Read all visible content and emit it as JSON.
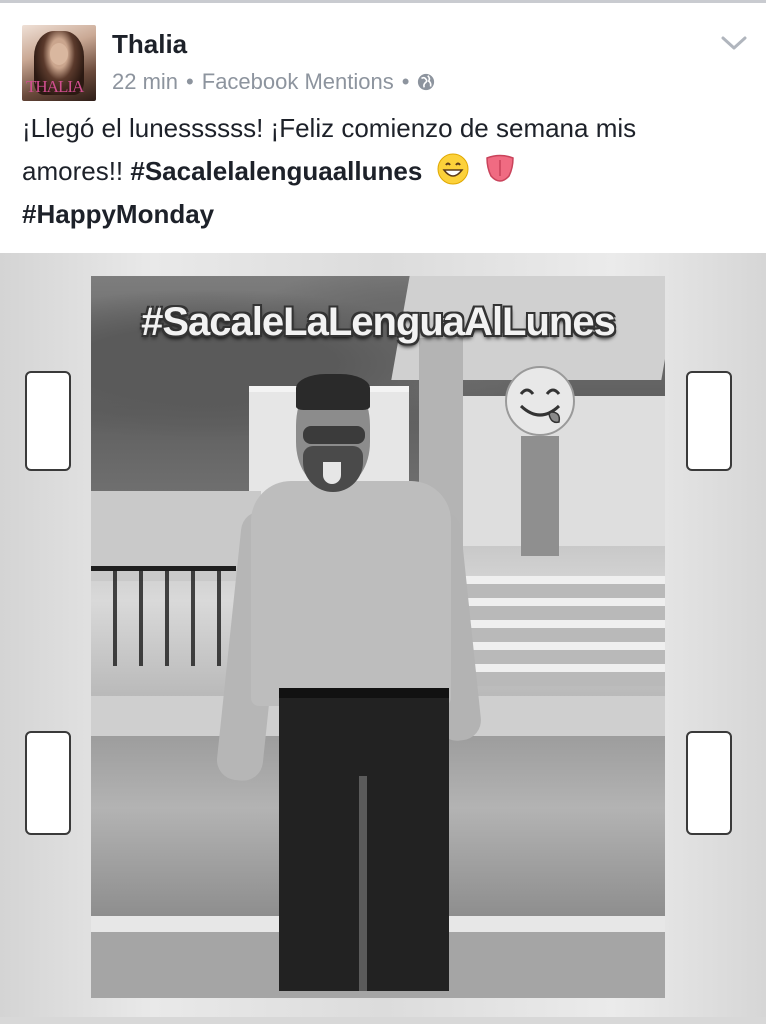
{
  "post": {
    "author": "Thalia",
    "avatar_text": "THALIA",
    "time": "22 min",
    "source": "Facebook Mentions",
    "text_line1": "¡Llegó el lunessssss! ¡Feliz comienzo de semana mis",
    "text_line2_prefix": "amores!! ",
    "hashtag1": "#Sacalelalenguaallunes",
    "hashtag2": "#HappyMonday"
  },
  "photo": {
    "overlay_text": "#SacaleLaLenguaAlLunes"
  },
  "icons": {
    "globe": "globe-icon",
    "menu": "chevron-down-icon",
    "emoji1": "grinning-face-emoji",
    "emoji2": "tongue-emoji",
    "sticker": "face-savoring-food-emoji"
  },
  "colors": {
    "text": "#1d2129",
    "meta": "#8d949e",
    "avatar_logo": "#d04e8f"
  }
}
